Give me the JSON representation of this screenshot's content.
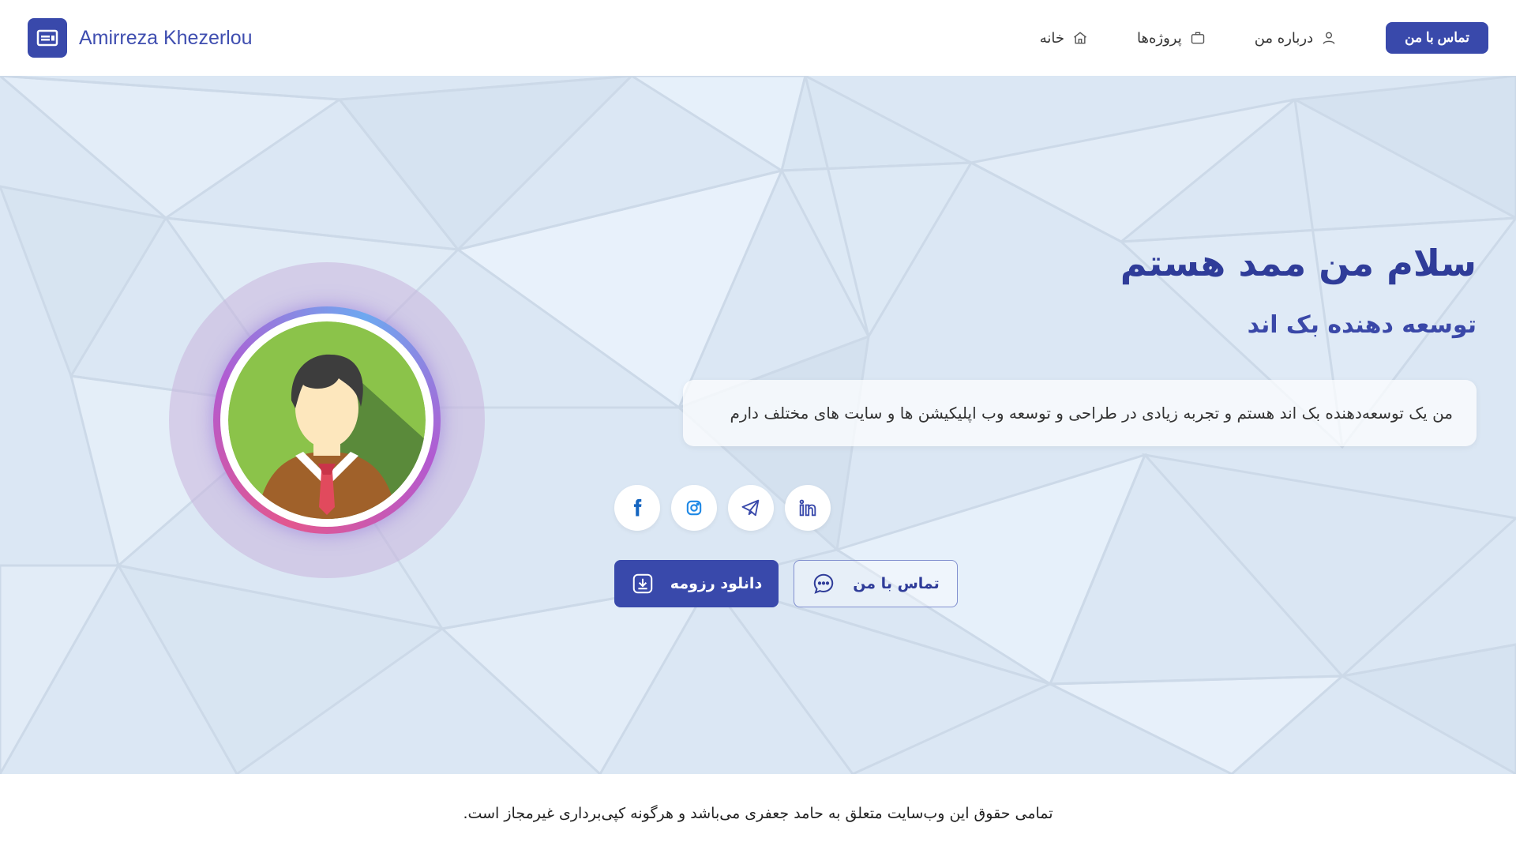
{
  "header": {
    "brand": "Amirreza Khezerlou",
    "nav": [
      {
        "label": "تماس با من",
        "icon": "button"
      },
      {
        "label": "درباره من",
        "icon": "user-icon"
      },
      {
        "label": "پروژه‌ها",
        "icon": "briefcase-icon"
      },
      {
        "label": "خانه",
        "icon": "home-icon"
      }
    ]
  },
  "hero": {
    "title": "سلام من ممد هستم",
    "subtitle": "توسعه دهنده بک اند",
    "description": "من یک توسعه‌دهنده بک اند هستم و تجربه زیادی در طراحی و توسعه وب اپلیکیشن ها و سایت های مختلف دارم",
    "socials": [
      "facebook-icon",
      "instagram-icon",
      "telegram-icon",
      "linkedin-icon"
    ],
    "buttons": {
      "resume": "دانلود رزومه",
      "contact": "تماس با من"
    }
  },
  "footer": {
    "text": "تمامی حقوق این وب‌سایت متعلق به حامد جعفری می‌باشد و هرگونه کپی‌برداری غیرمجاز است."
  },
  "colors": {
    "primary": "#3949ab",
    "hero_bg": "#dbe7f4",
    "title": "#2f3c99"
  }
}
